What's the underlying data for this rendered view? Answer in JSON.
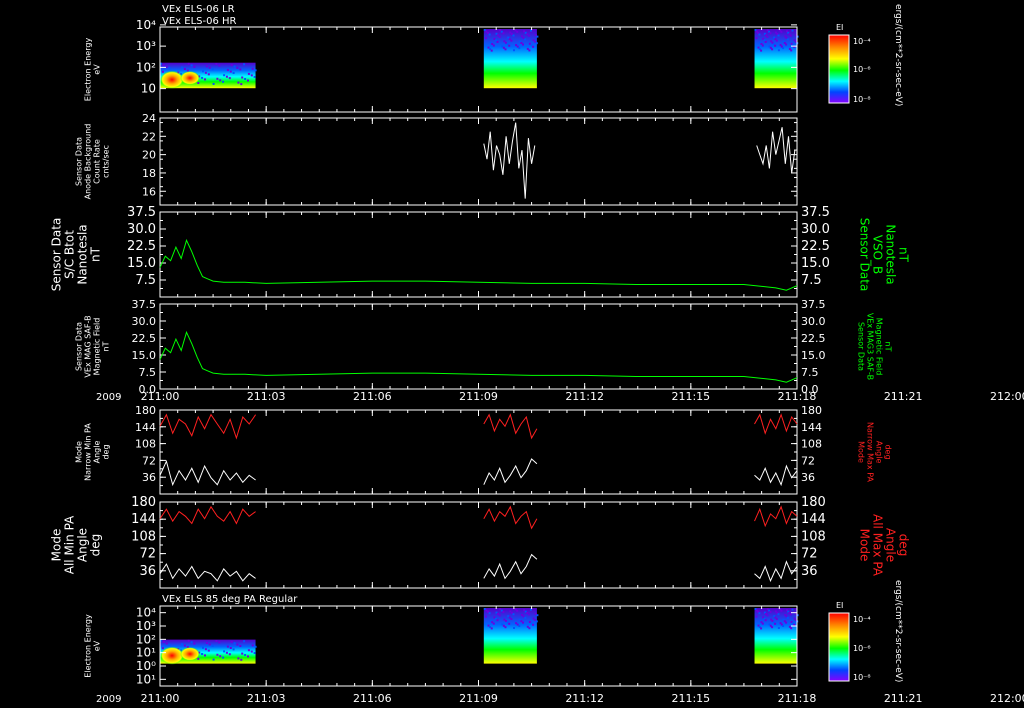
{
  "header": {
    "line1": "VEx ELS-06 LR",
    "line2": "VEx ELS-06 HR"
  },
  "panel7_title": "VEx ELS 85 deg PA Regular",
  "year": "2009",
  "time_ticks": [
    "211:00",
    "211:03",
    "211:06",
    "211:09",
    "211:12",
    "211:15",
    "211:18",
    "211:21",
    "212:00"
  ],
  "colorbar": {
    "title": "EI",
    "ticks": [
      "10⁻⁴",
      "10⁻⁶",
      "10⁻⁸"
    ],
    "units": "ergs/(cm**2-sr-sec-eV)"
  },
  "colors": {
    "background": "#000000",
    "frame": "#ffffff",
    "white_trace": "#ffffff",
    "green_trace": "#00ff00",
    "red_trace": "#ff2020"
  },
  "chart_data": [
    {
      "type": "heatmap",
      "panel": 1,
      "ylabel": [
        "Electron Energy",
        "eV"
      ],
      "yscale": "log",
      "yticks": [
        "10",
        "10²",
        "10³",
        "10⁴"
      ],
      "x_segments": [
        [
          0.0,
          0.9
        ],
        [
          3.05,
          3.55
        ],
        [
          5.6,
          6.0
        ]
      ],
      "description_colorbar": "EI"
    },
    {
      "type": "line",
      "panel": 2,
      "ylabel": [
        "Sensor Data",
        "Anode Background",
        "Count Rate",
        "cnts/sec"
      ],
      "ylim": [
        14.5,
        24
      ],
      "yticks": [
        "16",
        "18",
        "20",
        "22",
        "24"
      ],
      "series": [
        {
          "color": "white",
          "x": [
            3.05,
            3.08,
            3.11,
            3.14,
            3.17,
            3.2,
            3.23,
            3.26,
            3.29,
            3.32,
            3.35,
            3.38,
            3.41,
            3.44,
            3.47,
            3.5,
            3.53
          ],
          "y": [
            21.2,
            19.5,
            22.5,
            18.3,
            21.0,
            20.0,
            17.8,
            22.0,
            19.0,
            21.5,
            23.5,
            18.5,
            20.5,
            15.2,
            21.8,
            19.0,
            21.0
          ]
        },
        {
          "color": "white",
          "x": [
            5.62,
            5.65,
            5.68,
            5.71,
            5.74,
            5.77,
            5.8,
            5.83,
            5.86,
            5.89,
            5.92,
            5.95,
            5.98
          ],
          "y": [
            21.0,
            20.0,
            19.0,
            21.0,
            18.5,
            22.5,
            20.0,
            21.5,
            23.0,
            19.0,
            22.0,
            18.0,
            20.5
          ]
        }
      ]
    },
    {
      "type": "line",
      "panel": 3,
      "ylabel": [
        "Sensor Data",
        "S/C Btot",
        "Nanotesla",
        "nT"
      ],
      "ylabel_right": [
        "Sensor Data",
        "VSO_B",
        "Nanotesla",
        "nT"
      ],
      "ylim": [
        0,
        37.5
      ],
      "yticks": [
        "7.5",
        "15.0",
        "22.5",
        "30.0",
        "37.5"
      ],
      "series": [
        {
          "color": "green",
          "x": [
            0.0,
            0.05,
            0.1,
            0.15,
            0.2,
            0.25,
            0.3,
            0.35,
            0.4,
            0.45,
            0.5,
            0.6,
            0.8,
            1.0,
            1.5,
            2.0,
            2.5,
            3.0,
            3.5,
            4.0,
            4.5,
            5.0,
            5.5,
            5.8,
            5.9,
            6.0
          ],
          "y": [
            13,
            18,
            16,
            22,
            17,
            25,
            20,
            14,
            9,
            8,
            7,
            6.5,
            6.5,
            6,
            6.5,
            7,
            7,
            6.5,
            6,
            6,
            5.5,
            5.5,
            5.5,
            4,
            3,
            5
          ]
        }
      ]
    },
    {
      "type": "line",
      "panel": 4,
      "ylabel": [
        "Sensor Data",
        "VEx MAG SAF-B",
        "Magnetic Field",
        "nT"
      ],
      "ylabel_right": [
        "Sensor Data",
        "VEx MAG3 SAF-B",
        "Magnetic Field",
        "nT"
      ],
      "ylim": [
        0,
        37.5
      ],
      "yticks": [
        "0.0",
        "7.5",
        "15.0",
        "22.5",
        "30.0",
        "37.5"
      ],
      "series": [
        {
          "color": "green",
          "x": [
            0.0,
            0.05,
            0.1,
            0.15,
            0.2,
            0.25,
            0.3,
            0.35,
            0.4,
            0.45,
            0.5,
            0.6,
            0.8,
            1.0,
            1.5,
            2.0,
            2.5,
            3.0,
            3.5,
            4.0,
            4.5,
            5.0,
            5.5,
            5.8,
            5.9,
            6.0
          ],
          "y": [
            13,
            18,
            16,
            22,
            17,
            25,
            20,
            14,
            9,
            8,
            7,
            6.5,
            6.5,
            6,
            6.5,
            7,
            7,
            6.5,
            6,
            6,
            5.5,
            5.5,
            5.5,
            4,
            3,
            5
          ]
        }
      ]
    },
    {
      "type": "line",
      "panel": 5,
      "ylabel": [
        "Mode",
        "Narrow Min PA",
        "Angle",
        "deg"
      ],
      "ylabel_right": [
        "Mode",
        "Narrow Max PA",
        "Angle",
        "deg"
      ],
      "ylim": [
        0,
        180
      ],
      "yticks": [
        "36",
        "72",
        "108",
        "144",
        "180"
      ],
      "series": [
        {
          "color": "red",
          "x": [
            0.0,
            0.06,
            0.12,
            0.18,
            0.24,
            0.3,
            0.36,
            0.42,
            0.48,
            0.54,
            0.6,
            0.66,
            0.72,
            0.78,
            0.84,
            0.9
          ],
          "y": [
            145,
            170,
            130,
            160,
            150,
            125,
            165,
            140,
            170,
            150,
            130,
            160,
            120,
            165,
            150,
            170
          ]
        },
        {
          "color": "white",
          "x": [
            0.0,
            0.06,
            0.12,
            0.18,
            0.24,
            0.3,
            0.36,
            0.42,
            0.48,
            0.54,
            0.6,
            0.66,
            0.72,
            0.78,
            0.84,
            0.9
          ],
          "y": [
            40,
            70,
            20,
            50,
            30,
            55,
            25,
            60,
            35,
            20,
            50,
            30,
            45,
            25,
            40,
            30
          ]
        },
        {
          "color": "red",
          "x": [
            3.05,
            3.1,
            3.15,
            3.2,
            3.25,
            3.3,
            3.35,
            3.4,
            3.45,
            3.5,
            3.55
          ],
          "y": [
            150,
            170,
            135,
            160,
            145,
            170,
            130,
            150,
            165,
            120,
            140
          ]
        },
        {
          "color": "white",
          "x": [
            3.05,
            3.1,
            3.15,
            3.2,
            3.25,
            3.3,
            3.35,
            3.4,
            3.45,
            3.5,
            3.55
          ],
          "y": [
            20,
            45,
            30,
            55,
            25,
            40,
            60,
            35,
            50,
            75,
            65
          ]
        },
        {
          "color": "red",
          "x": [
            5.6,
            5.65,
            5.7,
            5.75,
            5.8,
            5.85,
            5.9,
            5.95,
            6.0
          ],
          "y": [
            150,
            170,
            130,
            160,
            140,
            170,
            135,
            165,
            150
          ]
        },
        {
          "color": "white",
          "x": [
            5.6,
            5.65,
            5.7,
            5.75,
            5.8,
            5.85,
            5.9,
            5.95,
            6.0
          ],
          "y": [
            40,
            30,
            55,
            25,
            45,
            20,
            60,
            35,
            50
          ]
        }
      ]
    },
    {
      "type": "line",
      "panel": 6,
      "ylabel": [
        "Mode",
        "All Min PA",
        "Angle",
        "deg"
      ],
      "ylabel_right": [
        "Mode",
        "All Max PA",
        "Angle",
        "deg"
      ],
      "ylim": [
        0,
        180
      ],
      "yticks": [
        "36",
        "72",
        "108",
        "144",
        "180"
      ],
      "series": [
        {
          "color": "red",
          "x": [
            0.0,
            0.06,
            0.12,
            0.18,
            0.24,
            0.3,
            0.36,
            0.42,
            0.48,
            0.54,
            0.6,
            0.66,
            0.72,
            0.78,
            0.84,
            0.9
          ],
          "y": [
            145,
            165,
            140,
            160,
            150,
            135,
            165,
            145,
            170,
            150,
            140,
            160,
            135,
            165,
            150,
            160
          ]
        },
        {
          "color": "white",
          "x": [
            0.0,
            0.06,
            0.12,
            0.18,
            0.24,
            0.3,
            0.36,
            0.42,
            0.48,
            0.54,
            0.6,
            0.66,
            0.72,
            0.78,
            0.84,
            0.9
          ],
          "y": [
            30,
            50,
            20,
            40,
            25,
            45,
            20,
            35,
            30,
            15,
            40,
            25,
            35,
            15,
            30,
            20
          ]
        },
        {
          "color": "red",
          "x": [
            3.05,
            3.1,
            3.15,
            3.2,
            3.25,
            3.3,
            3.35,
            3.4,
            3.45,
            3.5,
            3.55
          ],
          "y": [
            145,
            165,
            140,
            160,
            150,
            170,
            135,
            150,
            160,
            125,
            145
          ]
        },
        {
          "color": "white",
          "x": [
            3.05,
            3.1,
            3.15,
            3.2,
            3.25,
            3.3,
            3.35,
            3.4,
            3.45,
            3.5,
            3.55
          ],
          "y": [
            20,
            40,
            25,
            50,
            20,
            35,
            55,
            30,
            45,
            70,
            60
          ]
        },
        {
          "color": "red",
          "x": [
            5.6,
            5.65,
            5.7,
            5.75,
            5.8,
            5.85,
            5.9,
            5.95,
            6.0
          ],
          "y": [
            140,
            165,
            130,
            155,
            145,
            170,
            135,
            160,
            150
          ]
        },
        {
          "color": "white",
          "x": [
            5.6,
            5.65,
            5.7,
            5.75,
            5.8,
            5.85,
            5.9,
            5.95,
            6.0
          ],
          "y": [
            30,
            20,
            45,
            15,
            40,
            20,
            55,
            30,
            45
          ]
        }
      ]
    },
    {
      "type": "heatmap",
      "panel": 7,
      "ylabel": [
        "Electron Energy",
        "eV"
      ],
      "yscale": "log",
      "yticks": [
        "10¹",
        "10⁰",
        "10¹",
        "10²",
        "10³",
        "10⁴"
      ],
      "x_segments": [
        [
          0.0,
          0.9
        ],
        [
          3.05,
          3.55
        ],
        [
          5.6,
          6.0
        ]
      ]
    }
  ]
}
